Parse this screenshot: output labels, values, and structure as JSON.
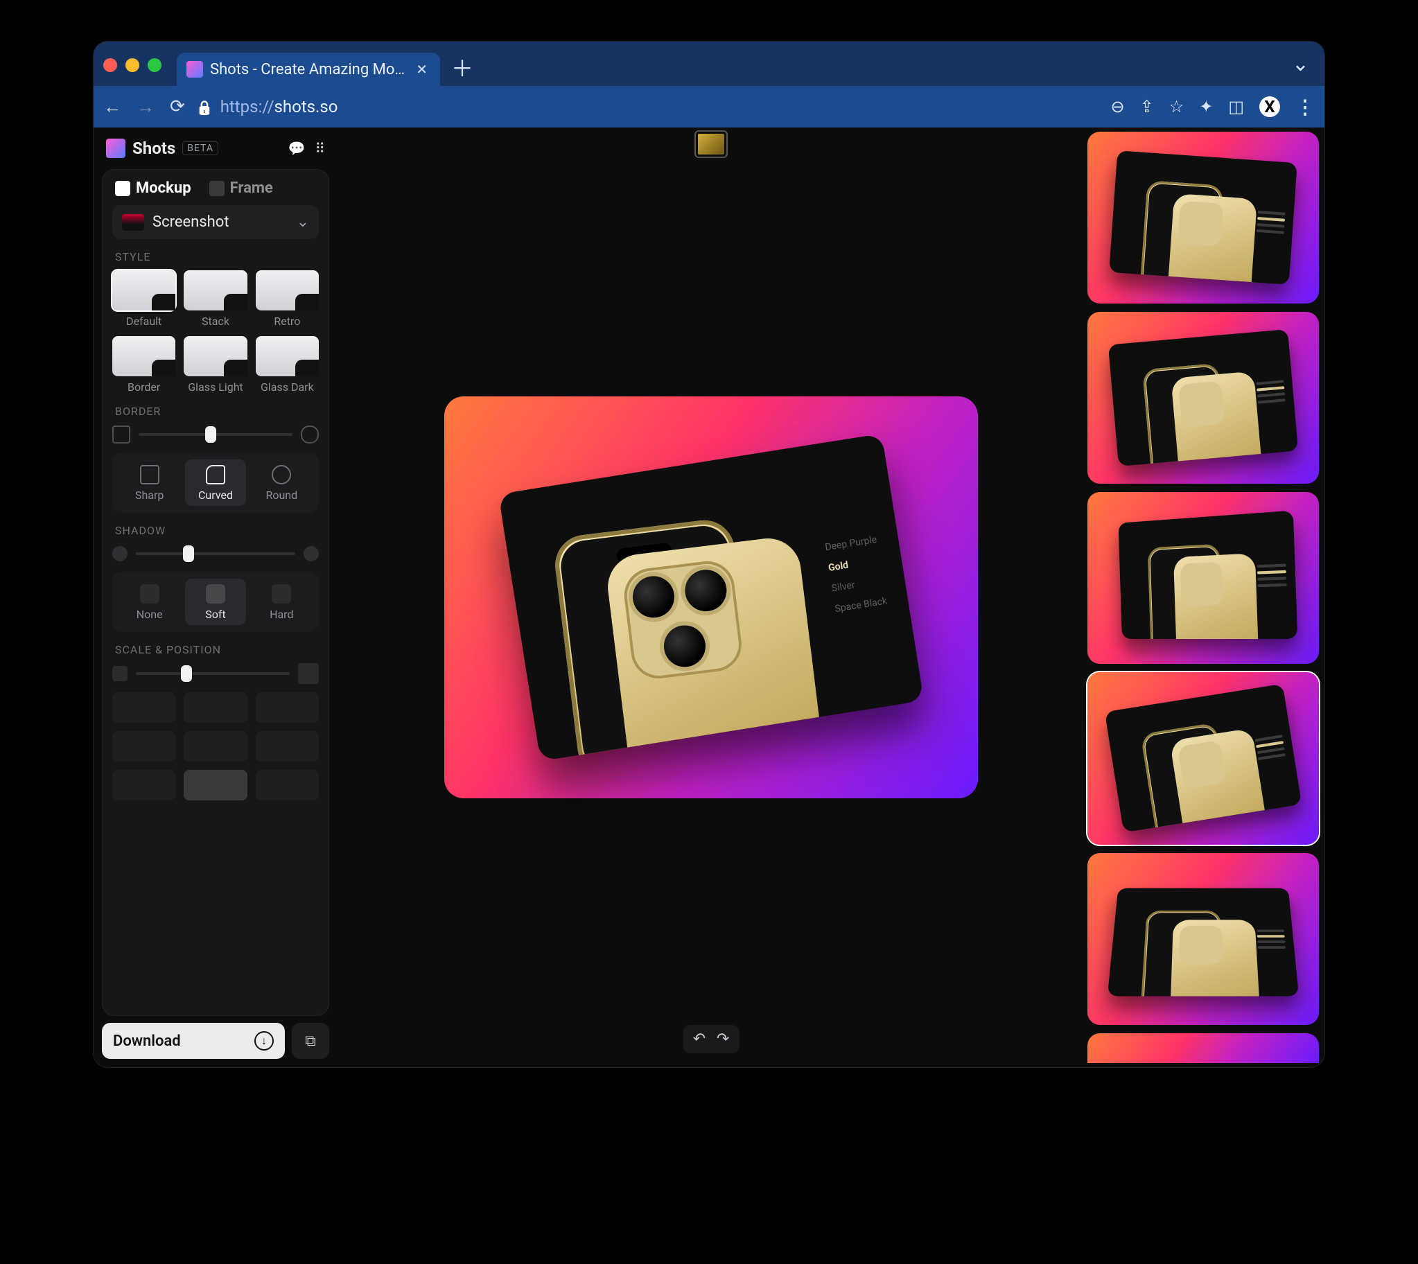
{
  "browser": {
    "tab_title": "Shots - Create Amazing Mocku",
    "url_scheme": "https://",
    "url_host": "shots.so"
  },
  "app": {
    "name": "Shots",
    "badge": "BETA"
  },
  "modes": {
    "mockup": "Mockup",
    "frame": "Frame"
  },
  "mockup_select": "Screenshot",
  "sections": {
    "style": "STYLE",
    "border": "BORDER",
    "shadow": "SHADOW",
    "scale": "SCALE & POSITION"
  },
  "styles": [
    {
      "label": "Default",
      "selected": true
    },
    {
      "label": "Stack",
      "selected": false
    },
    {
      "label": "Retro",
      "selected": false
    },
    {
      "label": "Border",
      "selected": false
    },
    {
      "label": "Glass Light",
      "selected": false
    },
    {
      "label": "Glass Dark",
      "selected": false
    }
  ],
  "border_opts": [
    {
      "label": "Sharp",
      "active": false
    },
    {
      "label": "Curved",
      "active": true
    },
    {
      "label": "Round",
      "active": false
    }
  ],
  "border_slider_pct": 47,
  "shadow_opts": [
    {
      "label": "None",
      "active": false
    },
    {
      "label": "Soft",
      "active": true
    },
    {
      "label": "Hard",
      "active": false
    }
  ],
  "shadow_slider_pct": 33,
  "scale_slider_pct": 33,
  "position_selected_index": 7,
  "download_label": "Download",
  "preview": {
    "color_options": [
      "Deep Purple",
      "Gold",
      "Silver",
      "Space Black"
    ],
    "active_color": "Gold"
  },
  "gallery_selected_index": 3
}
